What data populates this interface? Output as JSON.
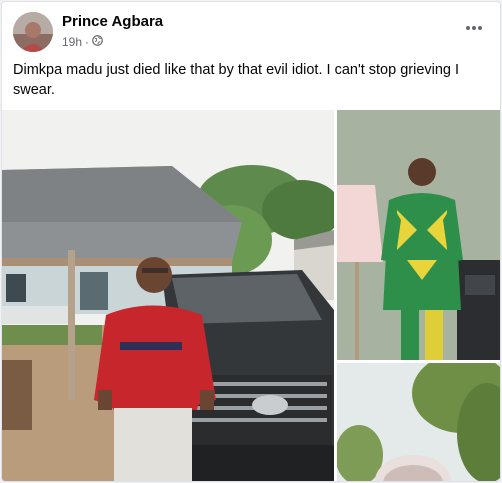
{
  "post": {
    "author": "Prince Agbara",
    "time": "19h",
    "separator": "·",
    "text": "Dimkpa madu just died like that by that evil idiot. I can't stop grieving I swear."
  },
  "icons": {
    "privacy": "globe-icon",
    "menu": "more-horizontal-icon"
  },
  "colors": {
    "text_primary": "#050505",
    "text_secondary": "#65676b"
  }
}
